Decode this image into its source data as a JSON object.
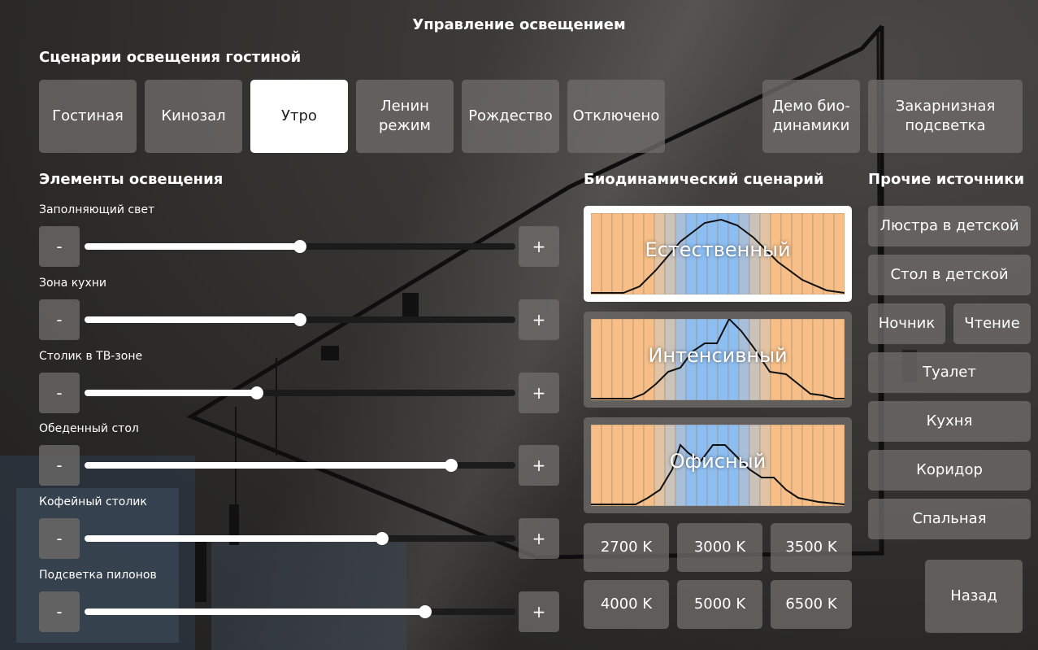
{
  "header": {
    "title": "Управление освещением"
  },
  "scenes": {
    "title": "Сценарии освещения гостиной",
    "items": [
      {
        "label": "Гостиная",
        "active": false
      },
      {
        "label": "Кинозал",
        "active": false
      },
      {
        "label": "Утро",
        "active": true
      },
      {
        "label": "Ленин режим",
        "active": false
      },
      {
        "label": "Рождество",
        "active": false
      },
      {
        "label": "Отключено",
        "active": false
      },
      {
        "label": "Демо био-динамики",
        "active": false
      },
      {
        "label": "Закарнизная подсветка",
        "active": false
      }
    ]
  },
  "lighting": {
    "title": "Элементы освещения",
    "minus_label": "-",
    "plus_label": "+",
    "items": [
      {
        "label": "Заполняющий свет",
        "level": 0.5
      },
      {
        "label": "Зона кухни",
        "level": 0.5
      },
      {
        "label": "Столик в ТВ-зоне",
        "level": 0.4
      },
      {
        "label": "Обеденный стол",
        "level": 0.85
      },
      {
        "label": "Кофейный столик",
        "level": 0.69
      },
      {
        "label": "Подсветка пилонов",
        "level": 0.79
      }
    ]
  },
  "biodynamic": {
    "title": "Биодинамический сценарий",
    "scenarios": [
      {
        "label": "Естественный",
        "active": true
      },
      {
        "label": "Интенсивный",
        "active": false
      },
      {
        "label": "Офисный",
        "active": false
      }
    ],
    "temperatures": [
      "2700 K",
      "3000 K",
      "3500 K",
      "4000 K",
      "5000 K",
      "6500 K"
    ]
  },
  "other": {
    "title": "Прочие источники",
    "items": [
      "Люстра в детской",
      "Стол в детской",
      "Ночник",
      "Чтение",
      "Туалет",
      "Кухня",
      "Коридор",
      "Спальная"
    ],
    "back_label": "Назад"
  },
  "colors": {
    "warm": "#f7be87",
    "mid_warm": "#e2c3a3",
    "neutral": "#c9c3bc",
    "cool": "#a8bfdc",
    "cold": "#8dbef2",
    "tile_bg": "#6e6c69",
    "active_bg": "#ffffff"
  }
}
